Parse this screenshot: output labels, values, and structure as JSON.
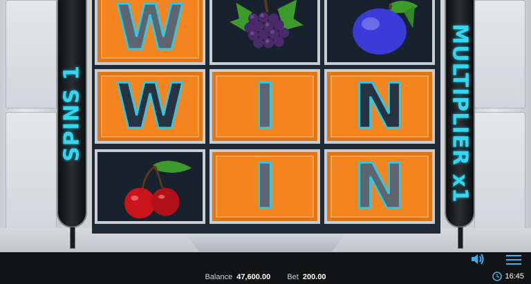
{
  "game": {
    "spins_label": "SPINS 1",
    "multiplier_label": "MULTIPLIER x1"
  },
  "reels": {
    "row1": [
      "W",
      "grapes",
      "plum"
    ],
    "row2": [
      "W",
      "I",
      "N"
    ],
    "row3": [
      "cherries",
      "I",
      "N"
    ]
  },
  "status_bar": {
    "balance_label": "Balance",
    "balance_value": "47,600.00",
    "bet_label": "Bet",
    "bet_value": "200.00",
    "time": "16:45"
  },
  "colors": {
    "accent": "#34d6f0",
    "tile": "#f3841e",
    "reel_bg": "#1f2a37"
  },
  "icons": [
    "sound-icon",
    "menu-icon",
    "clock-icon"
  ]
}
